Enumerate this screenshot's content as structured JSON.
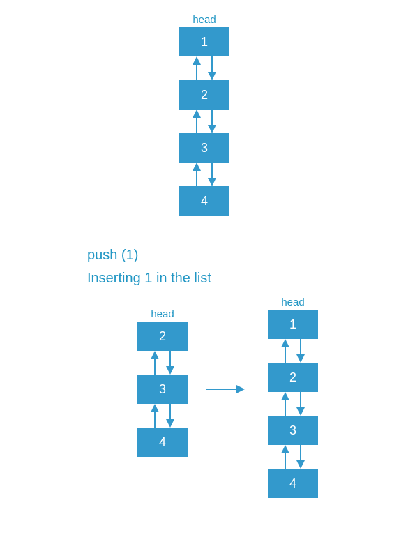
{
  "color": "#3399cc",
  "textColor": "#2196c4",
  "captions": {
    "push": "push (1)",
    "inserting": "Inserting 1 in the list"
  },
  "top": {
    "head": "head",
    "nodes": [
      "1",
      "2",
      "3",
      "4"
    ]
  },
  "bottomLeft": {
    "head": "head",
    "nodes": [
      "2",
      "3",
      "4"
    ]
  },
  "bottomRight": {
    "head": "head",
    "nodes": [
      "1",
      "2",
      "3",
      "4"
    ]
  },
  "arrowIcon": "arrow-right"
}
